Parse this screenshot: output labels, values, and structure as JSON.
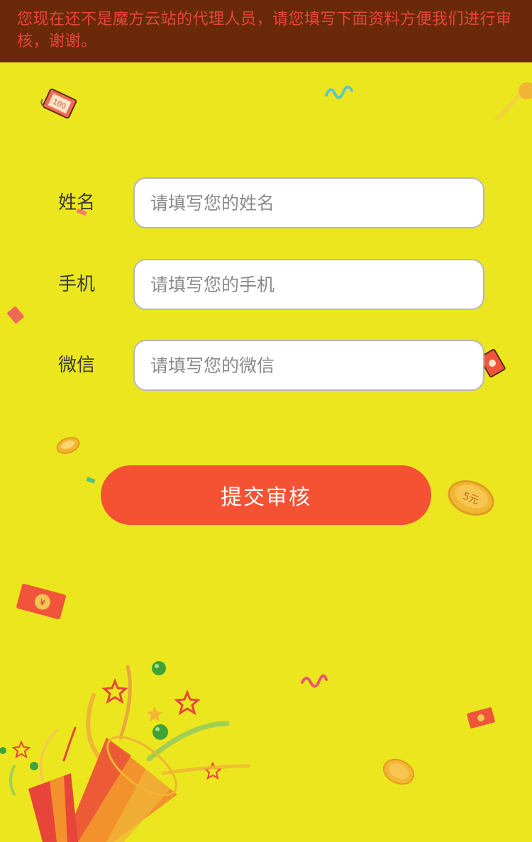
{
  "notice": {
    "text": "您现在还不是魔方云站的代理人员，请您填写下面资料方便我们进行审核，谢谢。"
  },
  "form": {
    "fields": [
      {
        "label": "姓名",
        "placeholder": "请填写您的姓名"
      },
      {
        "label": "手机",
        "placeholder": "请填写您的手机"
      },
      {
        "label": "微信",
        "placeholder": "请填写您的微信"
      }
    ],
    "submit_label": "提交审核"
  },
  "decorations": {
    "banknote_text": "100",
    "coin_text": "5元",
    "envelope_text": "¥"
  },
  "colors": {
    "background": "#ece61f",
    "notice_bg": "#6a2a0a",
    "notice_text": "#e8453a",
    "button": "#f55234",
    "input_border": "#b7b7b7"
  }
}
